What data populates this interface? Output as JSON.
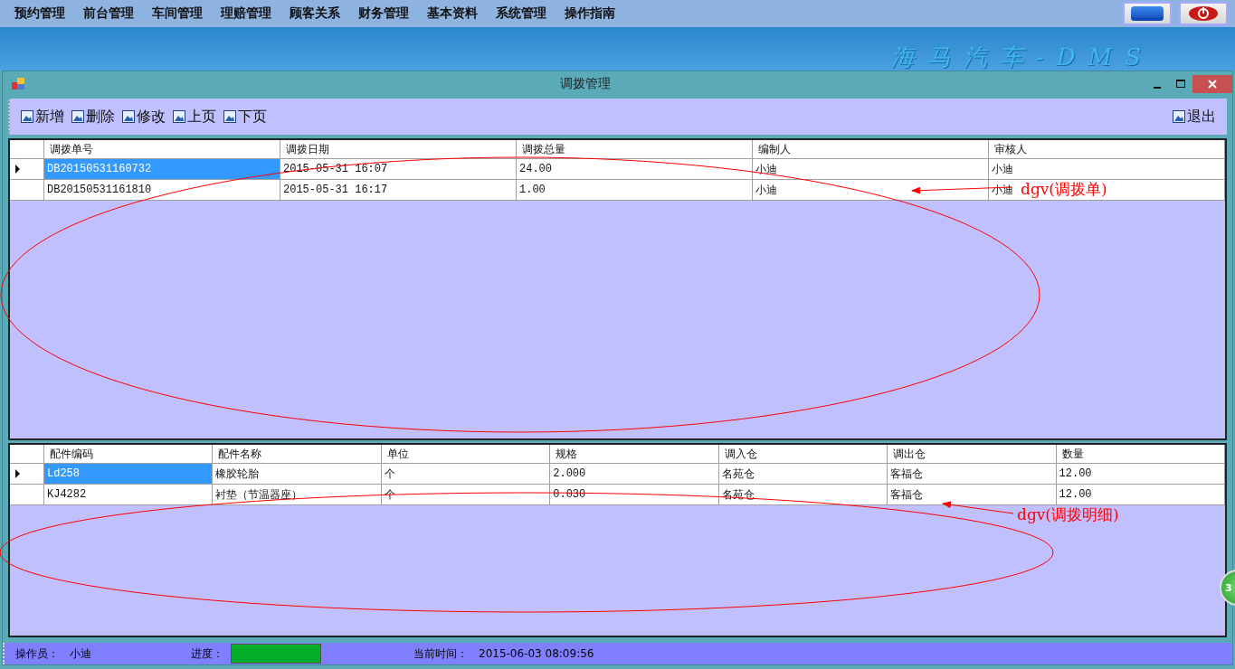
{
  "menu": [
    "预约管理",
    "前台管理",
    "车间管理",
    "理赔管理",
    "顾客关系",
    "财务管理",
    "基本资料",
    "系统管理",
    "操作指南"
  ],
  "banner_title": "海马汽车-DMS",
  "window": {
    "title": "调拨管理"
  },
  "toolbar": {
    "left": [
      "新增",
      "删除",
      "修改",
      "上页",
      "下页"
    ],
    "right": [
      "退出"
    ]
  },
  "transfer_grid": {
    "columns": [
      "调拨单号",
      "调拨日期",
      "调拨总量",
      "编制人",
      "审核人"
    ],
    "rows": [
      {
        "selected": true,
        "cells": [
          "DB20150531160732",
          "2015-05-31 16:07",
          "24.00",
          "小迪",
          "小迪"
        ]
      },
      {
        "selected": false,
        "cells": [
          "DB20150531161810",
          "2015-05-31 16:17",
          "1.00",
          "小迪",
          "小迪"
        ]
      }
    ]
  },
  "detail_grid": {
    "columns": [
      "配件编码",
      "配件名称",
      "单位",
      "规格",
      "调入仓",
      "调出仓",
      "数量"
    ],
    "rows": [
      {
        "selected": true,
        "cells": [
          "Ld258",
          "橡胶轮胎",
          "个",
          "2.000",
          "名苑仓",
          "客福仓",
          "12.00"
        ]
      },
      {
        "selected": false,
        "cells": [
          "KJ4282",
          "衬垫（节温器座）",
          "个",
          "0.030",
          "名苑仓",
          "客福仓",
          "12.00"
        ]
      }
    ]
  },
  "status_bar": {
    "operator_label": "操作员：",
    "operator": "小迪",
    "progress_label": "进度：",
    "progress": {
      "level": 1
    },
    "time_label": "当前时间：",
    "time": "2015-06-03 08:09:56"
  },
  "floating_badge": "3",
  "annotations": [
    {
      "text": "dgv(调拨单)"
    },
    {
      "text": "dgv(调拨明细)"
    }
  ]
}
